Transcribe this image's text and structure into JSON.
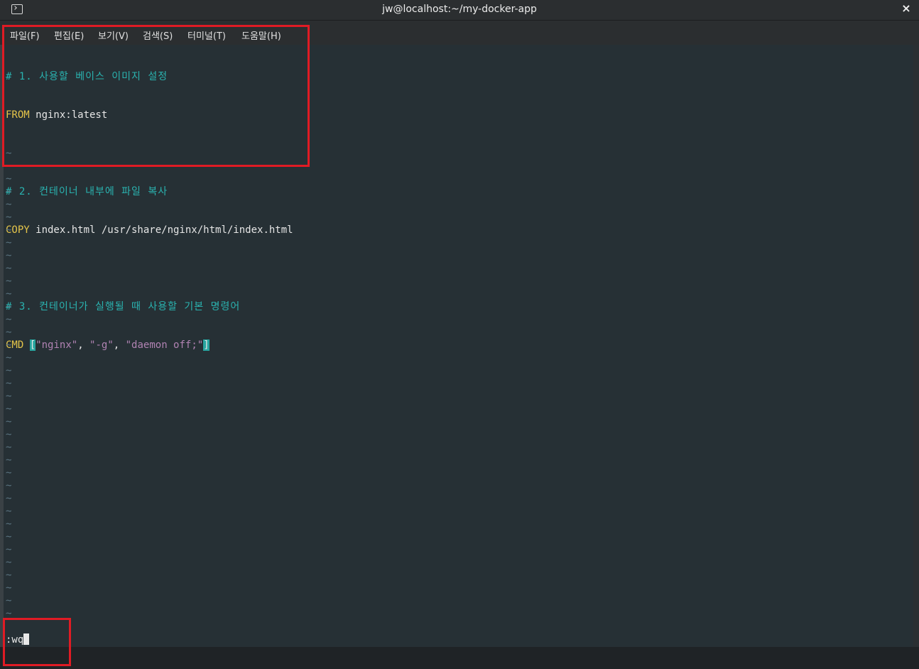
{
  "window": {
    "title": "jw@localhost:~/my-docker-app",
    "close_glyph": "×",
    "icon": "terminal-icon"
  },
  "menu": [
    {
      "label": "파일(F)"
    },
    {
      "label": "편집(E)"
    },
    {
      "label": "보기(V)"
    },
    {
      "label": "검색(S)"
    },
    {
      "label": "터미널(T)"
    },
    {
      "label": "도움말(H)"
    }
  ],
  "editor": {
    "comment1": "# 1. 사용할 베이스 이미지 설정",
    "from_kw": "FROM",
    "from_arg": " nginx:latest",
    "comment2": "# 2. 컨테이너 내부에 파일 복사",
    "copy_kw": "COPY",
    "copy_arg": " index.html /usr/share/nginx/html/index.html",
    "comment3": "# 3. 컨테이너가 실행될 때 사용할 기본 명령어",
    "cmd_kw": "CMD",
    "cmd_open": "[",
    "cmd_s1": "\"nginx\"",
    "cmd_sep1": ", ",
    "cmd_s2": "\"-g\"",
    "cmd_sep2": ", ",
    "cmd_s3": "\"daemon off;\"",
    "cmd_close": "]",
    "tilde": "~"
  },
  "command_line": {
    "text": ":wq"
  },
  "colors": {
    "background": "#263035",
    "comment": "#2ab3b0",
    "keyword": "#e5c54a",
    "string": "#b183b3",
    "annotation": "#e01b24"
  }
}
